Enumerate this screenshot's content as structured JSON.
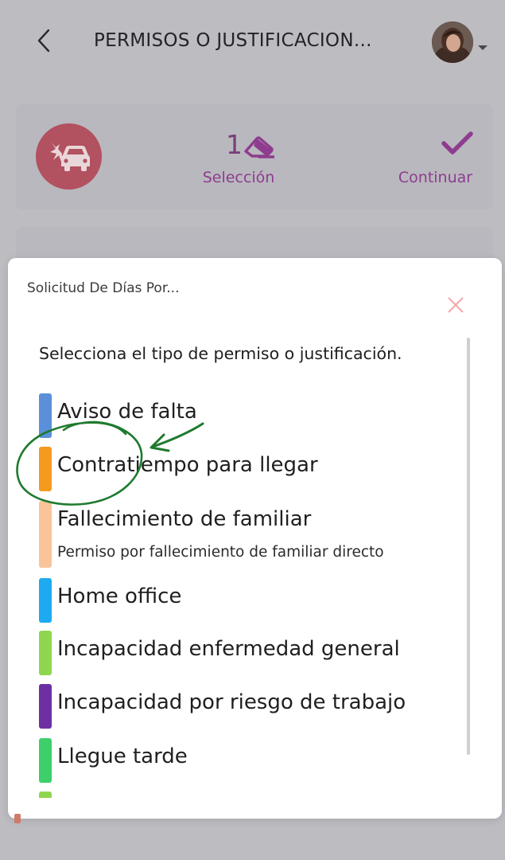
{
  "header": {
    "title": "PERMISOS O JUSTIFICACION...",
    "back_icon": "chevron-left-icon",
    "avatar_icon": "user-avatar",
    "caret_icon": "caret-down-icon"
  },
  "action_bar": {
    "type_icon": "car-crash-icon",
    "badge_color": "#b25160",
    "selection_count": "1",
    "selection_label": "Selección",
    "continue_label": "Continuar",
    "accent_color": "#8e3c8f"
  },
  "modal": {
    "title": "Solicitud De Días Por...",
    "instruction": "Selecciona el tipo de permiso o justificación.",
    "options": [
      {
        "label": "Aviso de falta",
        "color": "#5b8fd9"
      },
      {
        "label": "Contratiempo para llegar",
        "color": "#f59a1f"
      },
      {
        "label": "Fallecimiento de familiar",
        "description": "Permiso por fallecimiento de familiar directo",
        "color": "#f9c49a"
      },
      {
        "label": "Home office",
        "color": "#1eaaf1"
      },
      {
        "label": "Incapacidad enfermedad general",
        "color": "#8fd64f"
      },
      {
        "label": "Incapacidad por riesgo de trabajo",
        "color": "#6e2fa3"
      },
      {
        "label": "Llegue tarde",
        "color": "#3ccf6a"
      },
      {
        "label": "",
        "color": "#8fd64f"
      }
    ]
  },
  "annotation": {
    "color": "#1f7a2e"
  }
}
